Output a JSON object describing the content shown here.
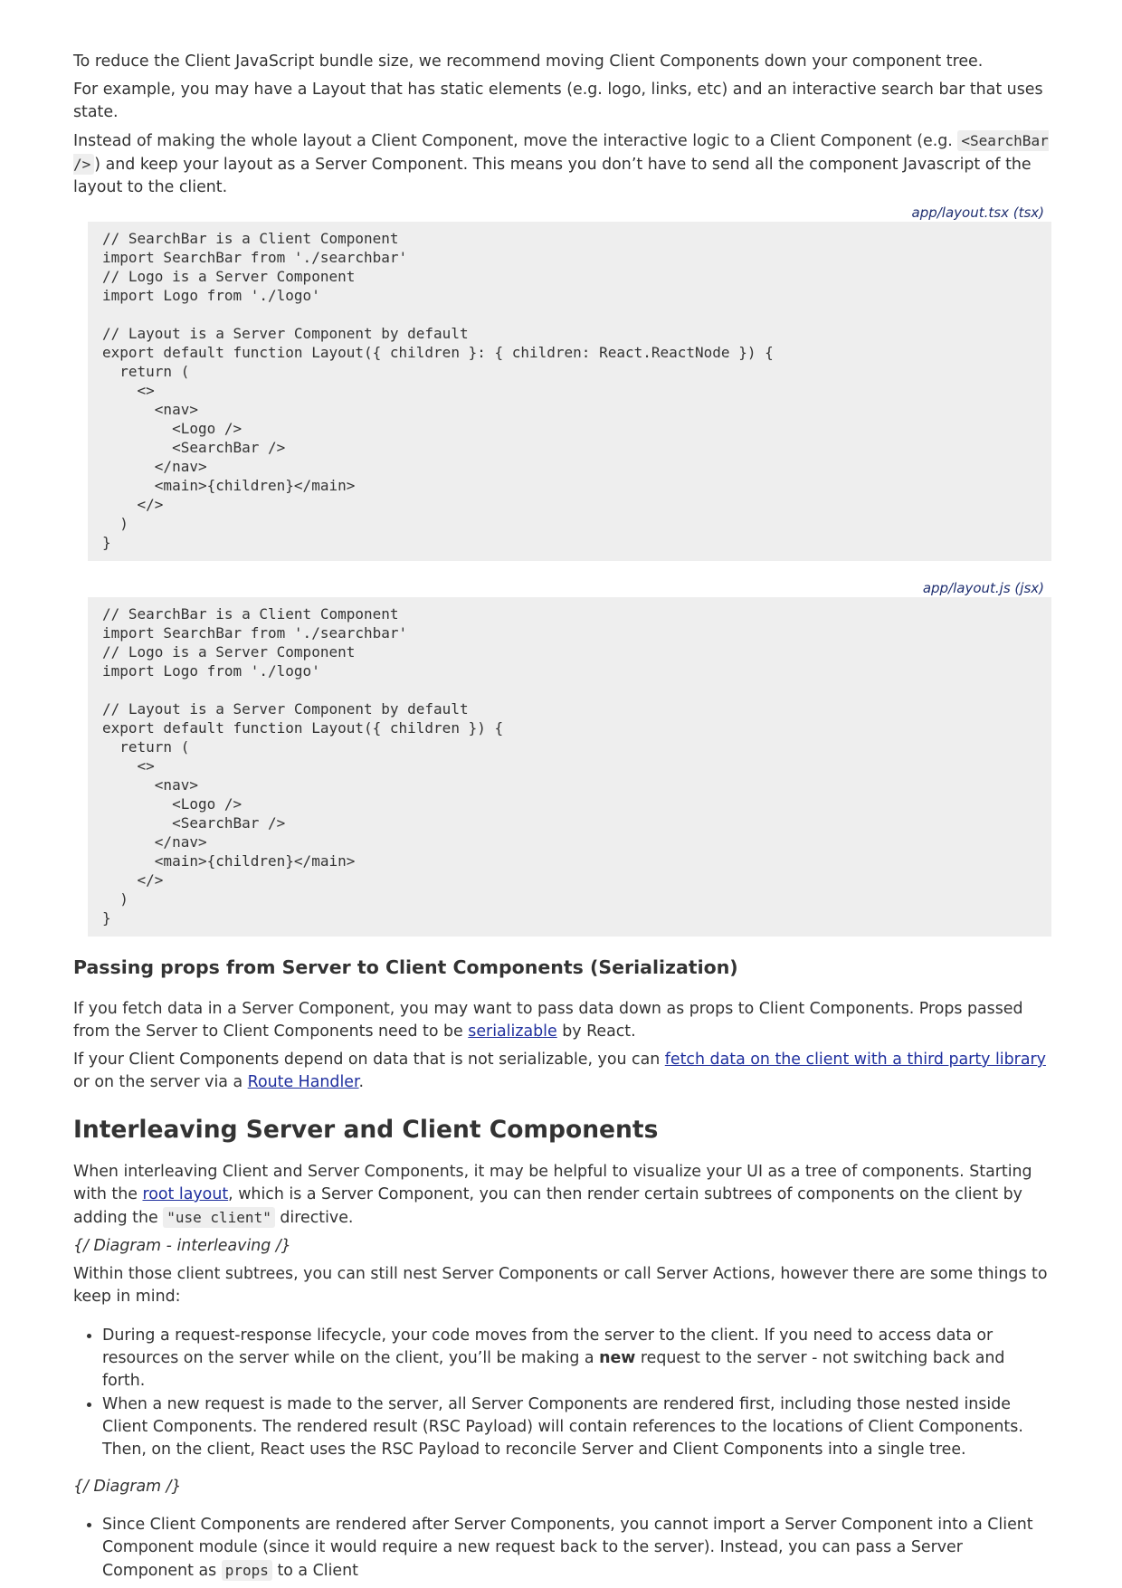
{
  "intro": {
    "p1": "To reduce the Client JavaScript bundle size, we recommend moving Client Components down your component tree.",
    "p2": "For example, you may have a Layout that has static elements (e.g. logo, links, etc) and an interactive search bar that uses state.",
    "p3_a": "Instead of making the whole layout a Client Component, move the interactive logic to a Client Component (e.g. ",
    "p3_code": "<SearchBar />",
    "p3_b": ") and keep your layout as a Server Component. This means you don’t have to send all the component Javascript of the layout to the client."
  },
  "code_tsx": {
    "caption": "app/layout.tsx (tsx)",
    "code": "// SearchBar is a Client Component\nimport SearchBar from './searchbar'\n// Logo is a Server Component\nimport Logo from './logo'\n\n// Layout is a Server Component by default\nexport default function Layout({ children }: { children: React.ReactNode }) {\n  return (\n    <>\n      <nav>\n        <Logo />\n        <SearchBar />\n      </nav>\n      <main>{children}</main>\n    </>\n  )\n}"
  },
  "code_jsx": {
    "caption": "app/layout.js (jsx)",
    "code": "// SearchBar is a Client Component\nimport SearchBar from './searchbar'\n// Logo is a Server Component\nimport Logo from './logo'\n\n// Layout is a Server Component by default\nexport default function Layout({ children }) {\n  return (\n    <>\n      <nav>\n        <Logo />\n        <SearchBar />\n      </nav>\n      <main>{children}</main>\n    </>\n  )\n}"
  },
  "props_section": {
    "heading": "Passing props from Server to Client Components (Serialization)",
    "p1_a": "If you fetch data in a Server Component, you may want to pass data down as props to Client Components. Props passed from the Server to Client Components need to be ",
    "p1_link": "serializable",
    "p1_b": " by React.",
    "p2_a": "If your Client Components depend on data that is not serializable, you can ",
    "p2_link1": "fetch data on the client with a third party library",
    "p2_b": " or on the server via a ",
    "p2_link2": "Route Handler",
    "p2_c": "."
  },
  "interleaving": {
    "heading": "Interleaving Server and Client Components",
    "p1_a": "When interleaving Client and Server Components, it may be helpful to visualize your UI as a tree of components. Starting with the ",
    "p1_link": "root layout",
    "p1_b": ", which is a Server Component, you can then render certain subtrees of components on the client by adding the ",
    "p1_code": "\"use client\"",
    "p1_c": " directive.",
    "diagram1": "{/ Diagram - interleaving /}",
    "p2": "Within those client subtrees, you can still nest Server Components or call Server Actions, however there are some things to keep in mind:",
    "bullet1_a": "During a request-response lifecycle, your code moves from the server to the client. If you need to access data or resources on the server while on the client, you’ll be making a ",
    "bullet1_bold": "new",
    "bullet1_b": " request to the server - not switching back and forth.",
    "bullet2": "When a new request is made to the server, all Server Components are rendered first, including those nested inside Client Components. The rendered result (RSC Payload) will contain references to the locations of Client Components. Then, on the client, React uses the RSC Payload to reconcile Server and Client Components into a single tree.",
    "diagram2": "{/ Diagram /}",
    "bullet3_a": "Since Client Components are rendered after Server Components, you cannot import a Server Component into a Client Component module (since it would require a new request back to the server). Instead, you can pass a Server Component as ",
    "bullet3_code": "props",
    "bullet3_b": " to a Client"
  }
}
